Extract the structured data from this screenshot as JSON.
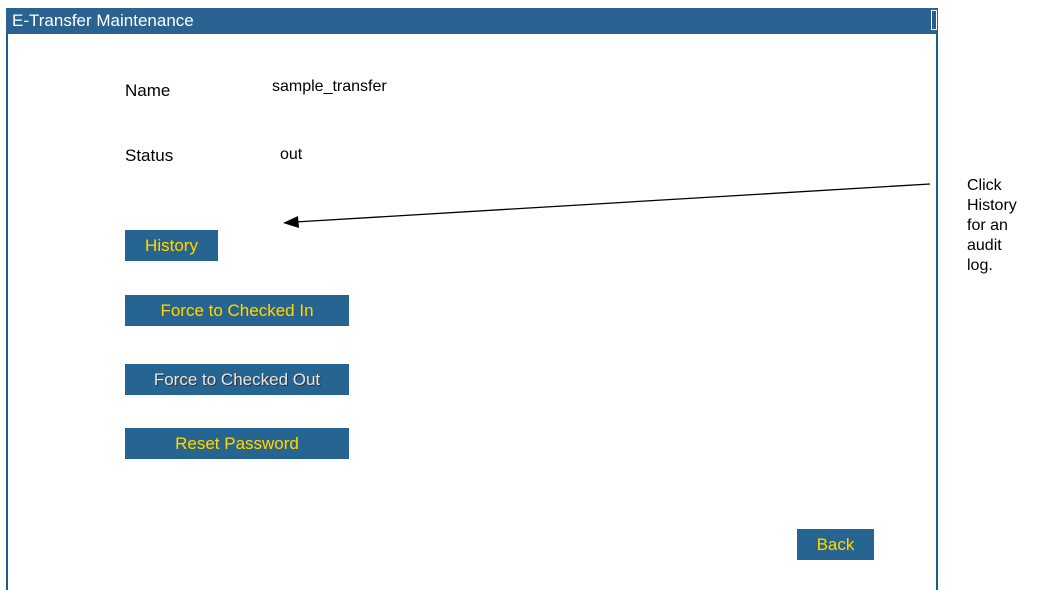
{
  "window": {
    "title": "E-Transfer Maintenance"
  },
  "fields": {
    "name_label": "Name",
    "name_value": "sample_transfer",
    "status_label": "Status",
    "status_value": "out"
  },
  "buttons": {
    "history": "History",
    "force_checked_in": "Force to Checked In",
    "force_checked_out": "Force to Checked Out",
    "reset_password": "Reset Password",
    "back": "Back"
  },
  "annotation": {
    "lines": [
      "Click",
      "History",
      "for an",
      "audit",
      "log."
    ]
  },
  "colors": {
    "titlebar": "#245f8e",
    "button_bg": "#1f5f8f",
    "button_text": "#ffd700",
    "disabled_text": "#e6e6e6"
  }
}
